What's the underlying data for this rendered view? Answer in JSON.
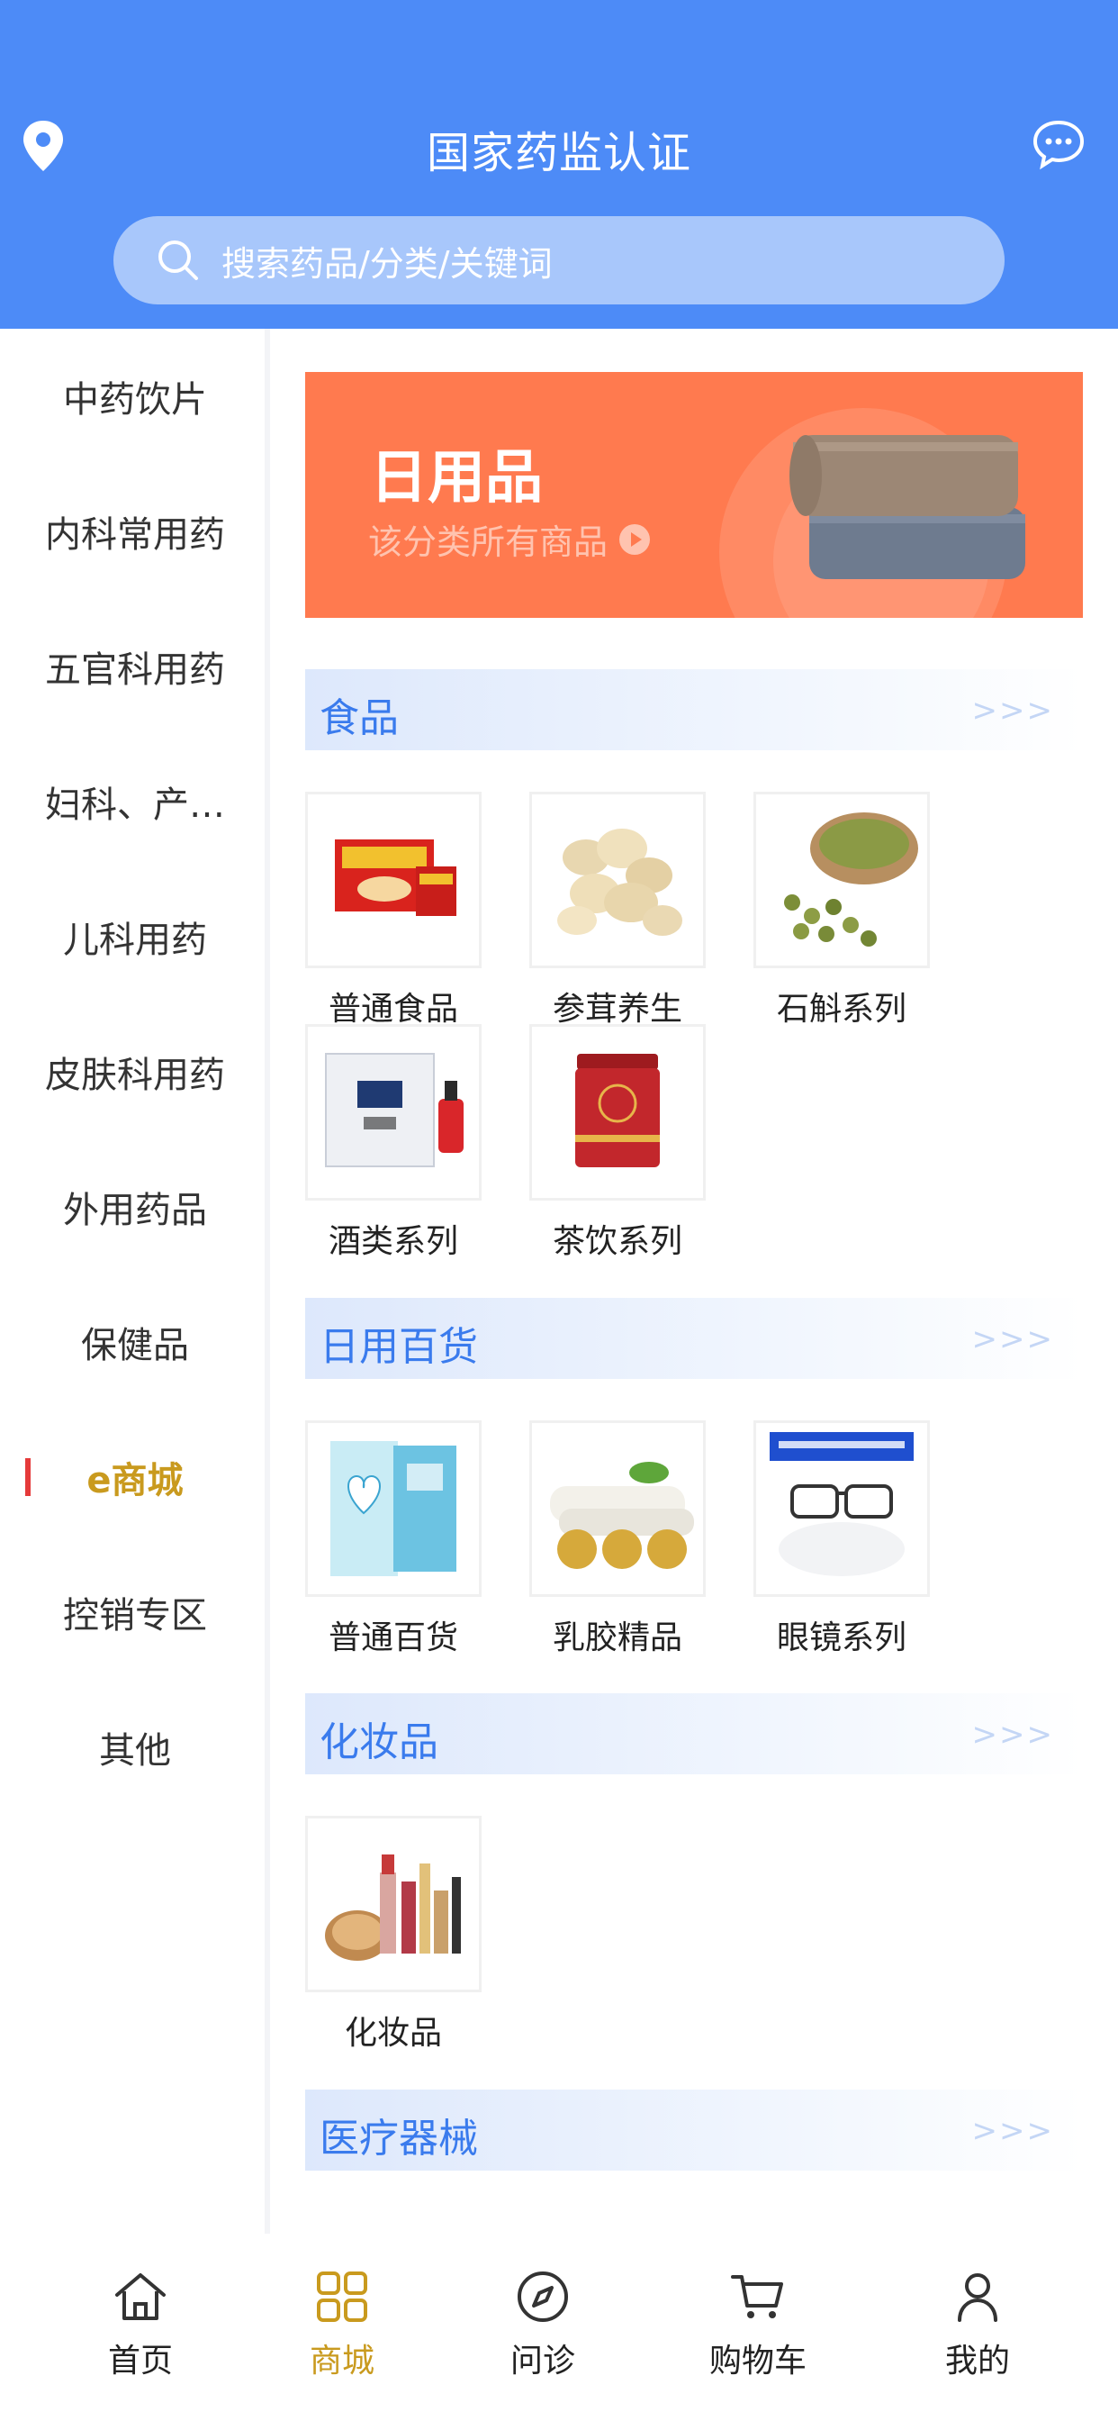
{
  "header": {
    "title": "国家药监认证",
    "search_placeholder": "搜索药品/分类/关键词"
  },
  "sidebar": {
    "items": [
      {
        "label": "中药饮片"
      },
      {
        "label": "内科常用药"
      },
      {
        "label": "五官科用药"
      },
      {
        "label": "妇科、产…"
      },
      {
        "label": "儿科用药"
      },
      {
        "label": "皮肤科用药"
      },
      {
        "label": "外用药品"
      },
      {
        "label": "保健品"
      },
      {
        "label": "e商城",
        "active": true
      },
      {
        "label": "控销专区"
      },
      {
        "label": "其他"
      }
    ]
  },
  "banner": {
    "title": "日用品",
    "subtitle": "该分类所有商品"
  },
  "sections": [
    {
      "title": "食品",
      "arrow": ">>>",
      "items": [
        "普通食品",
        "参茸养生",
        "石斛系列",
        "酒类系列",
        "茶饮系列"
      ]
    },
    {
      "title": "日用百货",
      "arrow": ">>>",
      "items": [
        "普通百货",
        "乳胶精品",
        "眼镜系列"
      ]
    },
    {
      "title": "化妆品",
      "arrow": ">>>",
      "items": [
        "化妆品"
      ]
    },
    {
      "title": "医疗器械",
      "arrow": ">>>",
      "items": []
    }
  ],
  "tabbar": {
    "items": [
      {
        "label": "首页",
        "icon": "home-icon"
      },
      {
        "label": "商城",
        "icon": "grid-icon",
        "active": true
      },
      {
        "label": "问诊",
        "icon": "compass-icon"
      },
      {
        "label": "购物车",
        "icon": "cart-icon"
      },
      {
        "label": "我的",
        "icon": "user-icon"
      }
    ]
  },
  "colors": {
    "primary": "#4d8bf7",
    "accent": "#c99a1e",
    "banner": "#ff7a4f",
    "section_title": "#3a7bed"
  }
}
